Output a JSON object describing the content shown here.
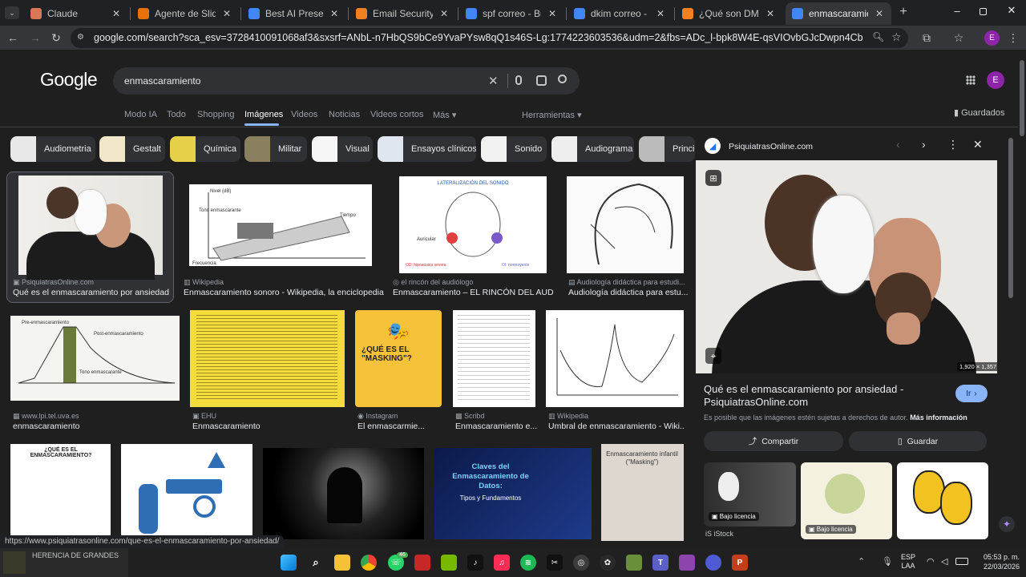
{
  "tabs": [
    {
      "title": "Claude",
      "fav": "claude-icon",
      "color": "#d97757"
    },
    {
      "title": "Agente de Slides IA",
      "fav": "loading-icon",
      "color": "#e8710a"
    },
    {
      "title": "Best AI Presentation",
      "fav": "b-icon",
      "color": "#4285f4"
    },
    {
      "title": "Email Security | Anti",
      "fav": "cloud-icon",
      "color": "#f38020"
    },
    {
      "title": "spf correo - Buscar c",
      "fav": "google-icon",
      "color": "#4285f4"
    },
    {
      "title": "dkim correo - Buscar",
      "fav": "google-icon",
      "color": "#4285f4"
    },
    {
      "title": "¿Qué son DMARC, D",
      "fav": "cloud-icon",
      "color": "#f38020"
    },
    {
      "title": "enmascaramiento - B",
      "fav": "google-icon",
      "color": "#4285f4"
    }
  ],
  "url": "google.com/search?sca_esv=3728410091068af3&sxsrf=ANbL-n7HbQS9bCe9YvaPYsw8qQ1s46S-Lg:1774223603536&udm=2&fbs=ADc_l-bpk8W4E-qsVIOvbGJcDwpn4CbM0gHaMP9RLFWGd8kHNhTJmj_r20...",
  "profile_initial": "E",
  "logo": "Google",
  "query": "enmascaramiento",
  "nav": [
    "Modo IA",
    "Todo",
    "Shopping",
    "Imágenes",
    "Videos",
    "Noticias",
    "Videos cortos",
    "Más"
  ],
  "tools": "Herramientas",
  "saved": "Guardados",
  "chips": [
    "Audiometria",
    "Gestalt",
    "Química",
    "Militar",
    "Visual",
    "Ensayos clínicos",
    "Sonido",
    "Audiograma",
    "Princip"
  ],
  "results": [
    {
      "src": "PsiquiatrasOnline.com",
      "cap": "Qué es el enmascaramiento por ansiedad ..."
    },
    {
      "src": "Wikipedia",
      "cap": "Enmascaramiento sonoro - Wikipedia, la enciclopedia..."
    },
    {
      "src": "el rincón del audiólogo",
      "cap": "Enmascaramiento – EL RINCÓN DEL AUDI..."
    },
    {
      "src": "Audiología didáctica para estudi...",
      "cap": "Audiología didáctica para estu..."
    },
    {
      "src": "www.lpi.tel.uva.es",
      "cap": "enmascaramiento"
    },
    {
      "src": "EHU",
      "cap": "Enmascaramiento"
    },
    {
      "src": "Instagram",
      "cap": "El enmascarmie..."
    },
    {
      "src": "Scribd",
      "cap": "Enmascaramiento e..."
    },
    {
      "src": "Wikipedia",
      "cap": "Umbral de enmascaramiento - Wiki..."
    }
  ],
  "thumb_text": {
    "nivel": "Nivel (dB)",
    "tono": "Tono enmascarante",
    "tiempo": "Tiempo",
    "frecuencia": "Frecuencia",
    "lateral": "LATERALIZACIÓN DEL SONIDO",
    "auricular": "Auricular",
    "od": "OD: hipoacusia severa",
    "oi": "OI: normoyente",
    "pre": "Pre-enmascaramiento",
    "post": "Post-enmascaramiento",
    "tonoenm": "Tono enmascarante",
    "masking": "¿QUÉ ES EL \"MASKING\"?",
    "queesenm": "¿QUÉ ES EL ENMASCARAMIENTO?",
    "claves": "Claves del Enmascaramiento de Datos:",
    "tipos": "Tipos y Fundamentos",
    "infantil": "Enmascaramiento infantil (\"Masking\")"
  },
  "panel": {
    "site": "PsiquiatrasOnline.com",
    "title": "Qué es el enmascaramiento por ansiedad - PsiquiatrasOnline.com",
    "go": "Ir",
    "size": "1,920 × 1,357",
    "note": "Es posible que las imágenes estén sujetas a derechos de autor.",
    "more": "Más información",
    "share": "Compartir",
    "save": "Guardar",
    "licence": "Bajo licencia",
    "istock": "iStock"
  },
  "status_url": "https://www.psiquiatrasonline.com/que-es-el-enmascaramiento-por-ansiedad/",
  "media": "HERENCIA DE GRANDES",
  "tray": {
    "lang": "ESP",
    "layout": "LAA",
    "time": "05:53 p. m.",
    "date": "22/03/2026",
    "whatsapp_badge": "46"
  }
}
